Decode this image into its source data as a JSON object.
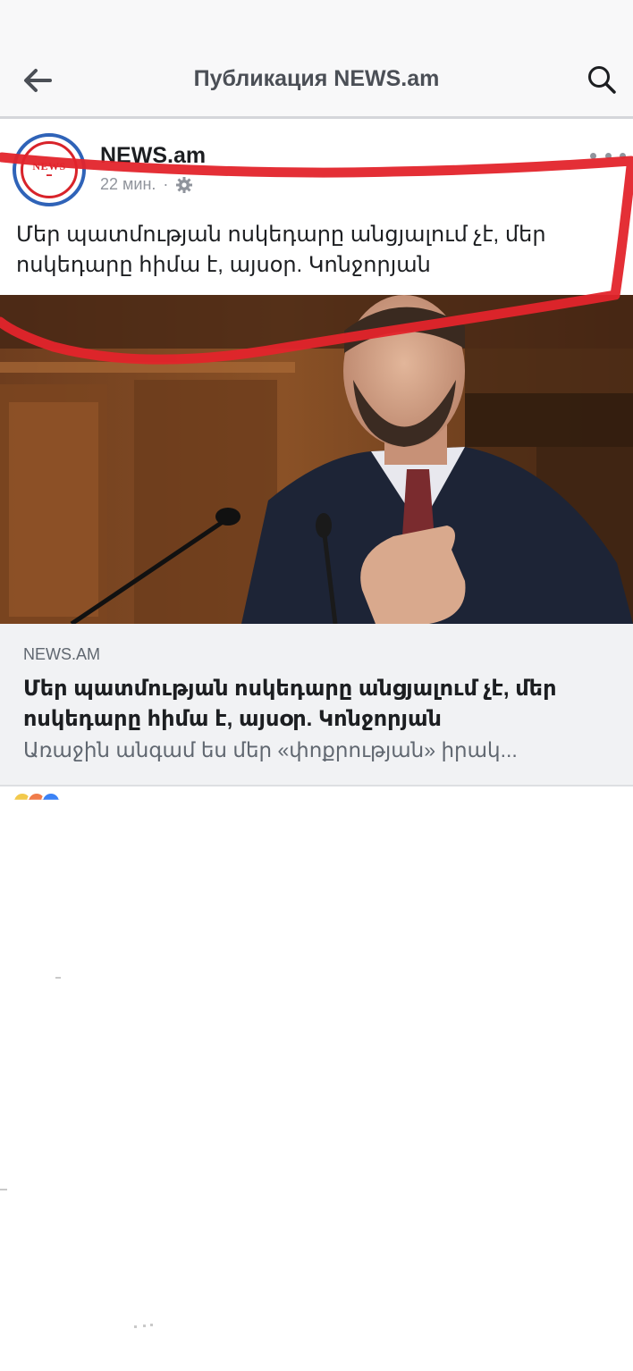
{
  "header": {
    "title": "Публикация NEWS.am",
    "back_icon": "arrow-left-icon",
    "search_icon": "search-icon"
  },
  "post": {
    "page_name": "NEWS.am",
    "avatar_logo_text": "NEWS",
    "timestamp": "22 мин.",
    "separator": "·",
    "privacy_icon": "gear-icon",
    "more_icon": "more-horizontal-icon",
    "text": "Մեր պատմության ոսկեդարը անցյալում չէ, մեր ոսկեդարը հիմա է, այսօր. Կոնջորյան"
  },
  "link_preview": {
    "domain": "NEWS.AM",
    "title": "Մեր պատմության ոսկեդարը անցյալում չէ, մեր ոսկեդարը հիմա է, այսօր. Կոնջորյան",
    "description": "Առաջին անգամ ես մեր «փոքրության» իրակ..."
  },
  "colors": {
    "accent_red": "#e3242b",
    "logo_blue": "#2f63b8",
    "header_bg": "#f8f8f9",
    "link_bg": "#f1f2f4"
  }
}
